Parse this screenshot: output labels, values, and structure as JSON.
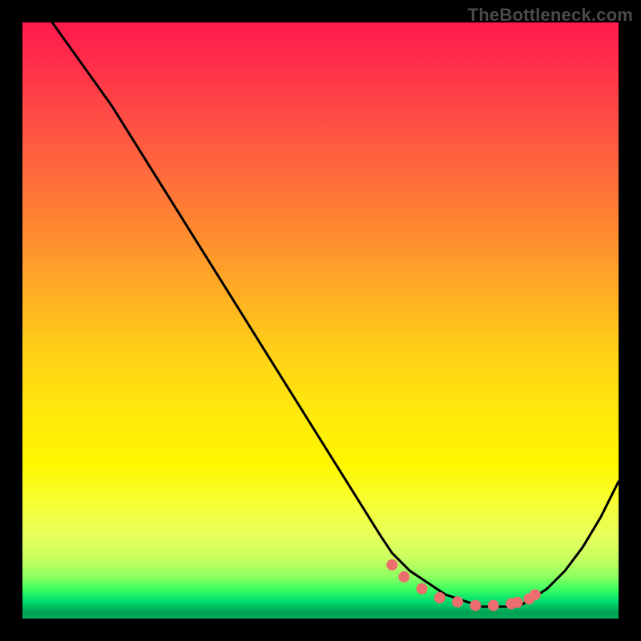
{
  "watermark": "TheBottleneck.com",
  "chart_data": {
    "type": "line",
    "title": "",
    "xlabel": "",
    "ylabel": "",
    "xlim": [
      0,
      100
    ],
    "ylim": [
      0,
      100
    ],
    "series": [
      {
        "name": "bottleneck-curve",
        "x": [
          5,
          10,
          15,
          20,
          25,
          30,
          35,
          40,
          45,
          50,
          55,
          60,
          62,
          65,
          68,
          71,
          74,
          77,
          80,
          83,
          85,
          88,
          91,
          94,
          97,
          100
        ],
        "y": [
          100,
          93,
          86,
          78,
          70,
          62,
          54,
          46,
          38,
          30,
          22,
          14,
          11,
          8,
          6,
          4,
          3,
          2,
          2,
          2,
          3,
          5,
          8,
          12,
          17,
          23
        ]
      }
    ],
    "markers": {
      "name": "optimal-range-dots",
      "x": [
        62,
        64,
        67,
        70,
        73,
        76,
        79,
        82,
        83,
        85,
        86
      ],
      "y": [
        9,
        7,
        5,
        3.5,
        2.8,
        2.2,
        2.2,
        2.5,
        2.7,
        3.3,
        4
      ]
    },
    "colors": {
      "curve": "#000000",
      "dots": "#ec6e6e",
      "gradient_top": "#ff1a4d",
      "gradient_bottom": "#00b060"
    }
  }
}
